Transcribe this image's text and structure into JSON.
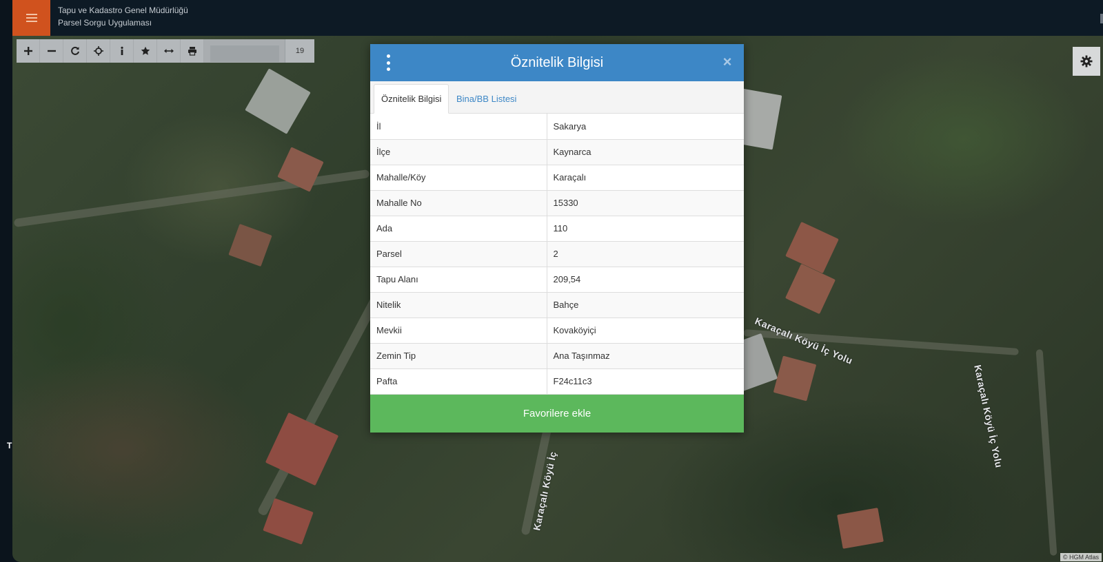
{
  "app": {
    "title_line1": "Tapu ve Kadastro Genel Müdürlüğü",
    "title_line2": "Parsel Sorgu Uygulaması"
  },
  "toolbar": {
    "zoom_level": "19",
    "icons": [
      "plus-icon",
      "minus-icon",
      "refresh-icon",
      "crosshair-icon",
      "info-icon",
      "star-icon",
      "arrows-horizontal-icon",
      "print-icon"
    ]
  },
  "map": {
    "road_labels": [
      "Karaçalı Köyü İç Yolu",
      "Karaçalı Köyü İç Yolu",
      "Karaçalı Köyü İç"
    ],
    "attribution": "© HGM Atlas"
  },
  "side_letter": "T",
  "modal": {
    "title": "Öznitelik Bilgisi",
    "tabs": [
      {
        "label": "Öznitelik Bilgisi",
        "active": true
      },
      {
        "label": "Bina/BB Listesi",
        "active": false
      }
    ],
    "rows": [
      {
        "key": "İl",
        "value": "Sakarya"
      },
      {
        "key": "İlçe",
        "value": "Kaynarca"
      },
      {
        "key": "Mahalle/Köy",
        "value": "Karaçalı"
      },
      {
        "key": "Mahalle No",
        "value": "15330"
      },
      {
        "key": "Ada",
        "value": "110"
      },
      {
        "key": "Parsel",
        "value": "2"
      },
      {
        "key": "Tapu Alanı",
        "value": "209,54"
      },
      {
        "key": "Nitelik",
        "value": "Bahçe"
      },
      {
        "key": "Mevkii",
        "value": "Kovaköyiçi"
      },
      {
        "key": "Zemin Tip",
        "value": "Ana Taşınmaz"
      },
      {
        "key": "Pafta",
        "value": "F24c11c3"
      }
    ],
    "favorite_button": "Favorilere ekle"
  },
  "colors": {
    "header_bg": "#0d1a25",
    "menu_accent": "#d0521e",
    "modal_header": "#3d87c6",
    "favorite_green": "#5cb85c"
  }
}
